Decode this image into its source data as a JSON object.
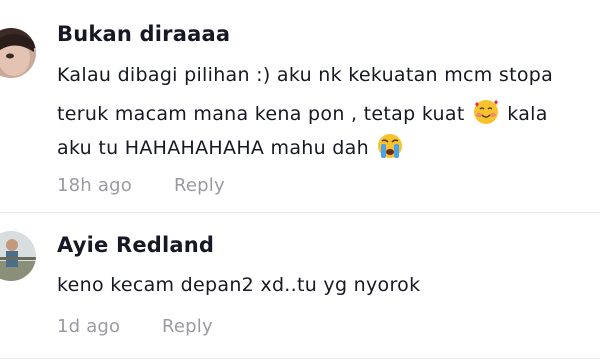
{
  "comments": [
    {
      "username": "Bukan diraaaa",
      "lines": [
        "Kalau dibagi pilihan :) aku nk kekuatan mcm stopa",
        "teruk macam mana kena pon , tetap kuat",
        "kala",
        "aku tu HAHAHAHAHA mahu dah"
      ],
      "emojis": [
        "smiling-face-with-hearts-emoji",
        "loudly-crying-face-emoji"
      ],
      "time": "18h ago",
      "reply_label": "Reply"
    },
    {
      "username": "Ayie Redland",
      "lines": [
        "keno kecam depan2 xd..tu yg nyorok"
      ],
      "time": "1d ago",
      "reply_label": "Reply"
    }
  ]
}
